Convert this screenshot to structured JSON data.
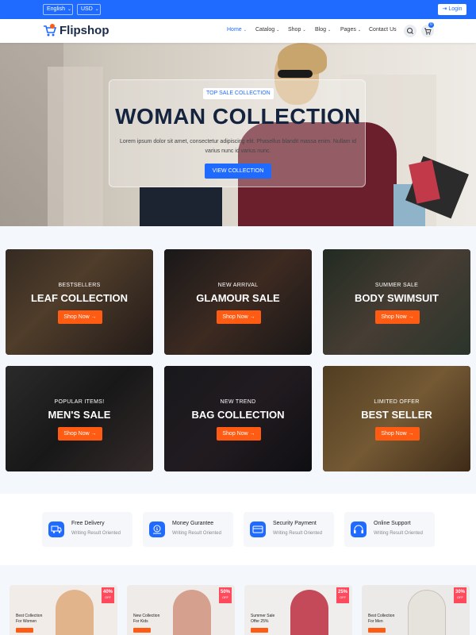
{
  "topbar": {
    "language": "English",
    "currency": "USD",
    "login_label": "Login"
  },
  "header": {
    "brand": "Flipshop",
    "nav": [
      "Home",
      "Catalog",
      "Shop",
      "Blog",
      "Pages",
      "Contact Us"
    ],
    "cart_count": "0"
  },
  "hero": {
    "tag": "TOP SALE COLLECTION",
    "title": "WOMAN COLLECTION",
    "description": "Lorem ipsum dolor sit amet, consectetur adipiscing elit. Phasellus blandit massa enim. Nullam id varius nunc id varius nunc.",
    "button": "VIEW COLLECTION"
  },
  "categories": [
    {
      "subtitle": "BESTSELLERS",
      "title": "LEAF COLLECTION",
      "button": "Shop Now"
    },
    {
      "subtitle": "NEW ARRIVAL",
      "title": "GLAMOUR SALE",
      "button": "Shop Now"
    },
    {
      "subtitle": "SUMMER SALE",
      "title": "BODY SWIMSUIT",
      "button": "Shop Now"
    },
    {
      "subtitle": "POPULAR ITEMS!",
      "title": "MEN'S SALE",
      "button": "Shop Now"
    },
    {
      "subtitle": "NEW TREND",
      "title": "BAG COLLECTION",
      "button": "Shop Now"
    },
    {
      "subtitle": "LIMITED OFFER",
      "title": "BEST SELLER",
      "button": "Shop Now"
    }
  ],
  "features": [
    {
      "title": "Free Delivery",
      "subtitle": "Writing Result Oriented",
      "icon": "truck-icon"
    },
    {
      "title": "Money Gurantee",
      "subtitle": "Writing Result Oriented",
      "icon": "money-icon"
    },
    {
      "title": "Security Payment",
      "subtitle": "Writing Result Oriented",
      "icon": "card-icon"
    },
    {
      "title": "Online Support",
      "subtitle": "Writing Result Oriented",
      "icon": "headset-icon"
    }
  ],
  "promos": [
    {
      "line1": "Best Collection",
      "line2": "For Women",
      "badge": "40%",
      "badge_sub": "OFF"
    },
    {
      "line1": "New Collection",
      "line2": "For Kids",
      "badge": "50%",
      "badge_sub": "OFF"
    },
    {
      "line1": "Summer Sale",
      "line2": "Offer 25%",
      "badge": "25%",
      "badge_sub": "OFF"
    },
    {
      "line1": "Best Collection",
      "line2": "For Men",
      "badge": "30%",
      "badge_sub": "OFF"
    }
  ],
  "colors": {
    "primary": "#1f6bff",
    "accent": "#ff5b12",
    "badge": "#ff4a5e",
    "heading": "#15243e"
  }
}
